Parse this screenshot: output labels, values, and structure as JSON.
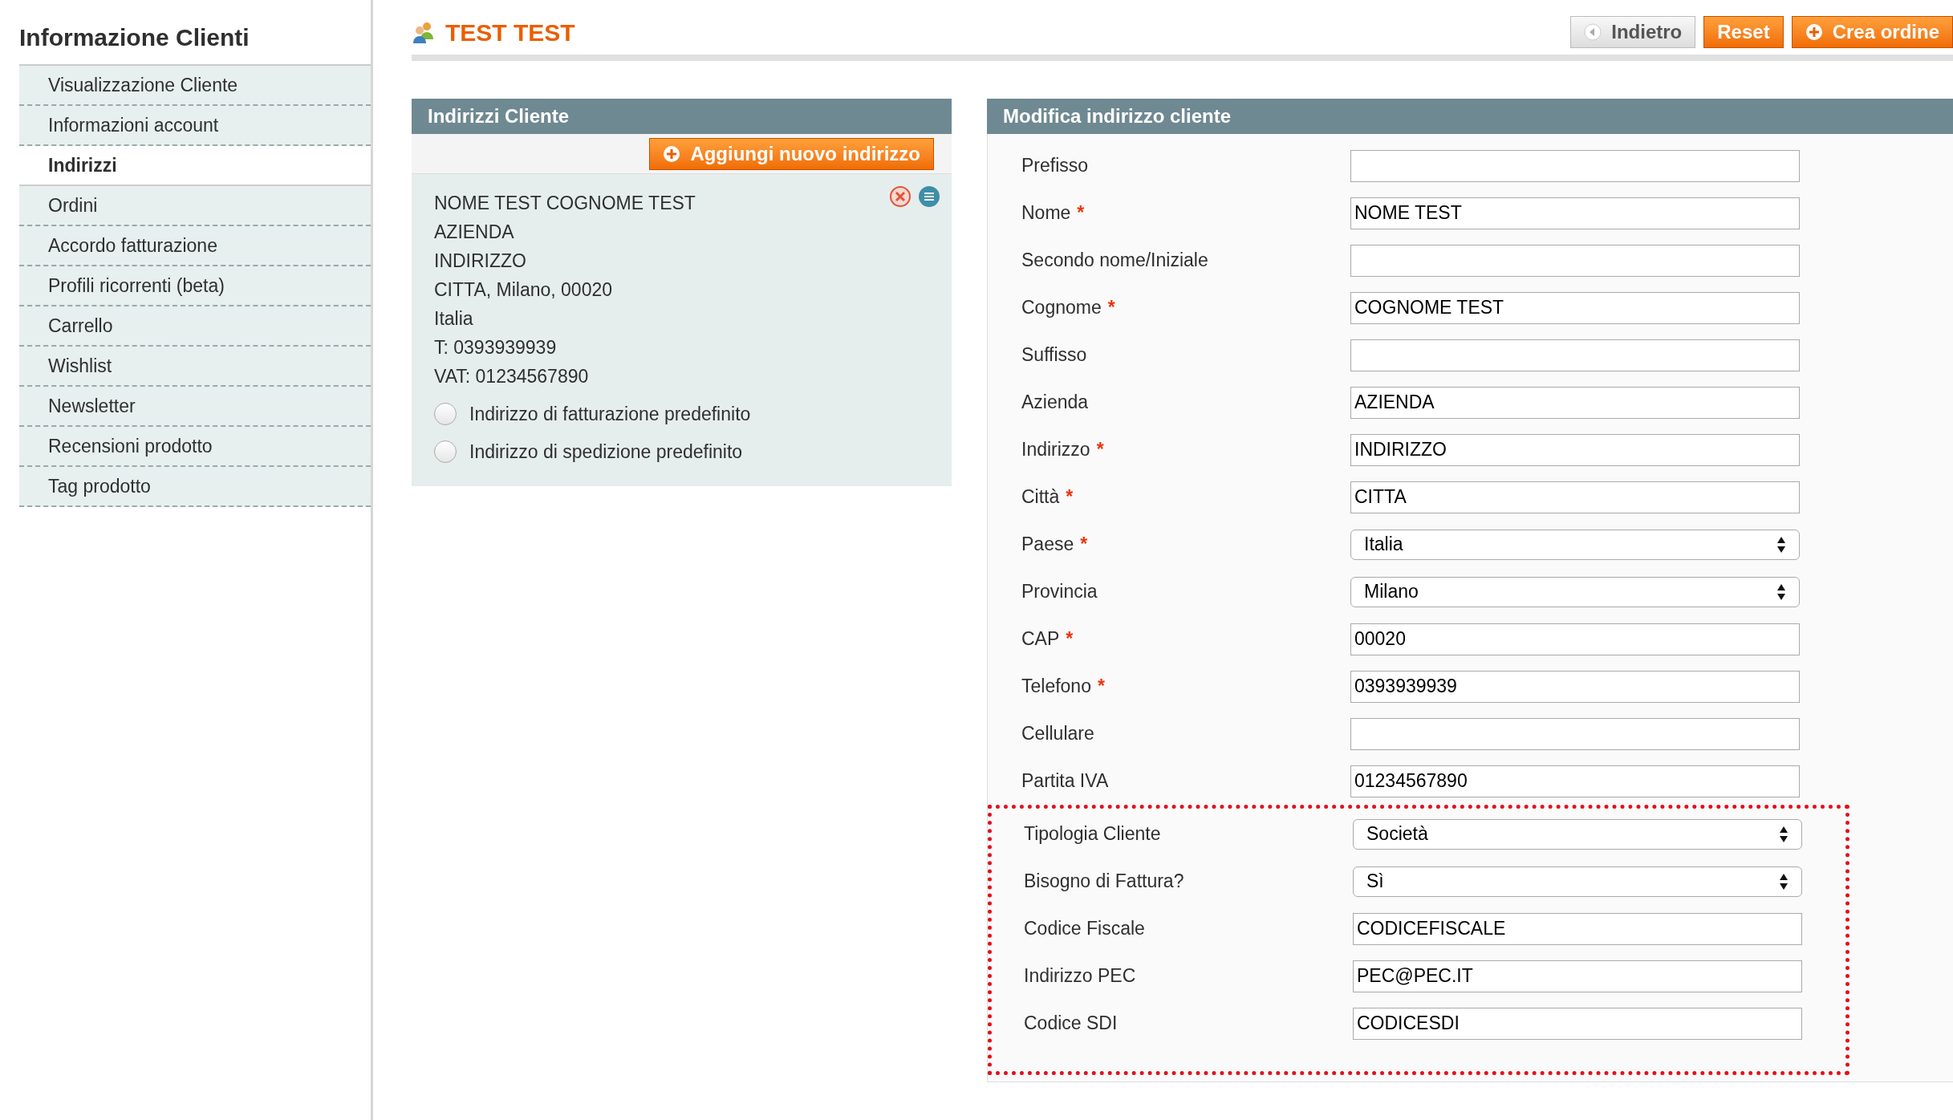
{
  "sidebar": {
    "title": "Informazione Clienti",
    "items": [
      {
        "label": "Visualizzazione Cliente",
        "selected": false
      },
      {
        "label": "Informazioni account",
        "selected": false
      },
      {
        "label": "Indirizzi",
        "selected": true
      },
      {
        "label": "Ordini",
        "selected": false
      },
      {
        "label": "Accordo fatturazione",
        "selected": false
      },
      {
        "label": "Profili ricorrenti (beta)",
        "selected": false
      },
      {
        "label": "Carrello",
        "selected": false
      },
      {
        "label": "Wishlist",
        "selected": false
      },
      {
        "label": "Newsletter",
        "selected": false
      },
      {
        "label": "Recensioni prodotto",
        "selected": false
      },
      {
        "label": "Tag prodotto",
        "selected": false
      }
    ]
  },
  "page": {
    "title": "TEST TEST",
    "buttons": [
      {
        "label": "Indietro",
        "kind": "back"
      },
      {
        "label": "Reset",
        "kind": "primary"
      },
      {
        "label": "Crea ordine",
        "kind": "add"
      }
    ]
  },
  "addresses": {
    "title": "Indirizzi Cliente",
    "add_button": "Aggiungi nuovo indirizzo",
    "lines": [
      "NOME TEST COGNOME TEST",
      "AZIENDA",
      "INDIRIZZO",
      "CITTA, Milano, 00020",
      "Italia",
      "T: 0393939939",
      "VAT: 01234567890"
    ],
    "options": [
      {
        "label": "Indirizzo di fatturazione predefinito",
        "selected": false
      },
      {
        "label": "Indirizzo di spedizione predefinito",
        "selected": false
      }
    ]
  },
  "form": {
    "title": "Modifica indirizzo cliente",
    "fields": [
      {
        "label": "Prefisso",
        "kind": "text"
      },
      {
        "label": "Nome",
        "required_mark": "*",
        "kind": "text",
        "value": "NOME TEST"
      },
      {
        "label": "Secondo nome/Iniziale",
        "kind": "text"
      },
      {
        "label": "Cognome",
        "required_mark": "*",
        "kind": "text",
        "value": "COGNOME TEST"
      },
      {
        "label": "Suffisso",
        "kind": "text"
      },
      {
        "label": "Azienda",
        "kind": "text",
        "value": "AZIENDA"
      },
      {
        "label": "Indirizzo",
        "required_mark": "*",
        "kind": "text",
        "value": "INDIRIZZO"
      },
      {
        "label": "Città",
        "required_mark": "*",
        "kind": "text",
        "value": "CITTA"
      },
      {
        "label": "Paese",
        "required_mark": "*",
        "kind": "select",
        "value": "Italia"
      },
      {
        "label": "Provincia",
        "kind": "select",
        "value": "Milano"
      },
      {
        "label": "CAP",
        "required_mark": "*",
        "kind": "text",
        "value": "00020"
      },
      {
        "label": "Telefono",
        "required_mark": "*",
        "kind": "text",
        "value": "0393939939"
      },
      {
        "label": "Cellulare",
        "kind": "text"
      },
      {
        "label": "Partita IVA",
        "kind": "text",
        "value": "01234567890"
      }
    ],
    "highlighted_fields": [
      {
        "label": "Tipologia Cliente",
        "kind": "select",
        "value": "Società"
      },
      {
        "label": "Bisogno di Fattura?",
        "kind": "select",
        "value": "Sì"
      },
      {
        "label": "Codice Fiscale",
        "kind": "text",
        "value": "CODICEFISCALE"
      },
      {
        "label": "Indirizzo PEC",
        "kind": "text",
        "value": "PEC@PEC.IT"
      },
      {
        "label": "Codice SDI",
        "kind": "text",
        "value": "CODICESDI"
      }
    ]
  }
}
